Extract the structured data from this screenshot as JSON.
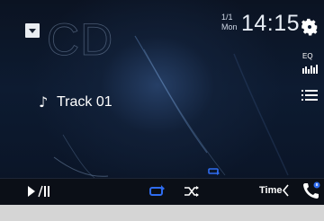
{
  "source": {
    "title": "CD"
  },
  "clock": {
    "date_month_day": "1/1",
    "weekday": "Mon",
    "time": "14:15"
  },
  "track": {
    "label": "Track 01"
  },
  "icons": {
    "source_menu": "chevron-down-icon",
    "settings": "gear-icon",
    "eq": "equalizer-icon",
    "menu": "list-menu-icon",
    "note": "music-note-icon",
    "play_pause": "play-pause-icon",
    "repeat": "repeat-icon",
    "shuffle": "shuffle-icon",
    "phone": "phone-icon"
  },
  "eq_label": "EQ",
  "bottom_bar": {
    "time_label": "Time"
  },
  "colors": {
    "accent_blue": "#2f6cf0",
    "background": "#0d1b31",
    "bar": "#0b0f17"
  }
}
